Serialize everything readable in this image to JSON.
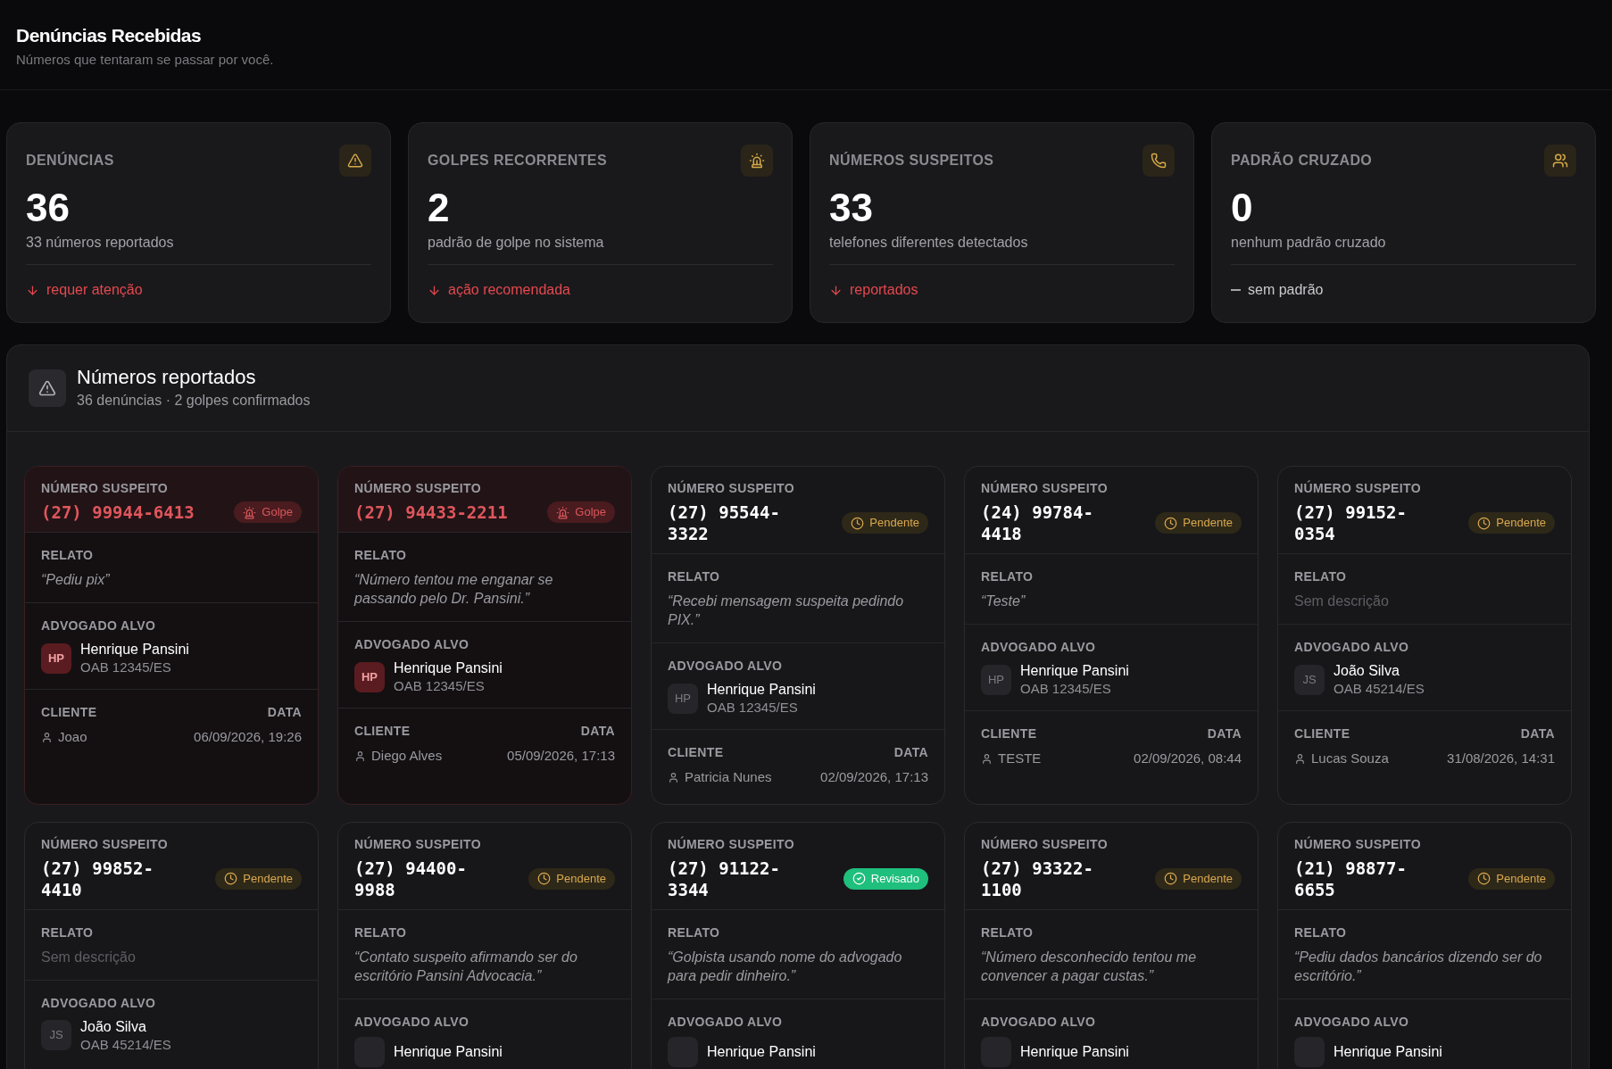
{
  "header": {
    "title": "Denúncias Recebidas",
    "subtitle": "Números que tentaram se passar por você."
  },
  "stats": [
    {
      "label": "DENÚNCIAS",
      "value": "36",
      "caption": "33 números reportados",
      "kind": "down",
      "note": "requer atenção"
    },
    {
      "label": "GOLPES RECORRENTES",
      "value": "2",
      "caption": "padrão de golpe no sistema",
      "kind": "down",
      "note": "ação recomendada"
    },
    {
      "label": "NÚMEROS SUSPEITOS",
      "value": "33",
      "caption": "telefones diferentes detectados",
      "kind": "down",
      "note": "reportados"
    },
    {
      "label": "PADRÃO CRUZADO",
      "value": "0",
      "caption": "nenhum padrão cruzado",
      "kind": "flat",
      "note": "sem padrão"
    }
  ],
  "section": {
    "title": "Números reportados",
    "subtitle": "36 denúncias · 2 golpes confirmados"
  },
  "reports": [
    {
      "number_label": "NÚMERO SUSPEITO",
      "number": "(27) 99944-6413",
      "status": {
        "kind": "golpe",
        "label": "Golpe"
      },
      "report_label": "RELATO",
      "report": "“Pediu pix”",
      "has_report": true,
      "lawyer_label": "ADVOGADO ALVO",
      "lawyer": {
        "initials": "HP",
        "name": "Henrique Pansini",
        "oab": "OAB 12345/ES"
      },
      "client_label": "CLIENTE",
      "client": "Joao",
      "date_label": "DATA",
      "date": "06/09/2026, 19:26"
    },
    {
      "number_label": "NÚMERO SUSPEITO",
      "number": "(27) 94433-2211",
      "status": {
        "kind": "golpe",
        "label": "Golpe"
      },
      "report_label": "RELATO",
      "report": "“Número tentou me enganar se passando pelo Dr. Pansini.”",
      "has_report": true,
      "lawyer_label": "ADVOGADO ALVO",
      "lawyer": {
        "initials": "HP",
        "name": "Henrique Pansini",
        "oab": "OAB 12345/ES"
      },
      "client_label": "CLIENTE",
      "client": "Diego Alves",
      "date_label": "DATA",
      "date": "05/09/2026, 17:13"
    },
    {
      "number_label": "NÚMERO SUSPEITO",
      "number": "(27) 95544-3322",
      "status": {
        "kind": "pendente",
        "label": "Pendente"
      },
      "report_label": "RELATO",
      "report": "“Recebi mensagem suspeita pedindo PIX.”",
      "has_report": true,
      "lawyer_label": "ADVOGADO ALVO",
      "lawyer": {
        "initials": "HP",
        "name": "Henrique Pansini",
        "oab": "OAB 12345/ES"
      },
      "client_label": "CLIENTE",
      "client": "Patricia Nunes",
      "date_label": "DATA",
      "date": "02/09/2026, 17:13"
    },
    {
      "number_label": "NÚMERO SUSPEITO",
      "number": "(24) 99784-4418",
      "status": {
        "kind": "pendente",
        "label": "Pendente"
      },
      "report_label": "RELATO",
      "report": "“Teste”",
      "has_report": true,
      "lawyer_label": "ADVOGADO ALVO",
      "lawyer": {
        "initials": "HP",
        "name": "Henrique Pansini",
        "oab": "OAB 12345/ES"
      },
      "client_label": "CLIENTE",
      "client": "TESTE",
      "date_label": "DATA",
      "date": "02/09/2026, 08:44"
    },
    {
      "number_label": "NÚMERO SUSPEITO",
      "number": "(27) 99152-0354",
      "status": {
        "kind": "pendente",
        "label": "Pendente"
      },
      "report_label": "RELATO",
      "report": "Sem descrição",
      "has_report": false,
      "lawyer_label": "ADVOGADO ALVO",
      "lawyer": {
        "initials": "JS",
        "name": "João Silva",
        "oab": "OAB 45214/ES"
      },
      "client_label": "CLIENTE",
      "client": "Lucas Souza",
      "date_label": "DATA",
      "date": "31/08/2026, 14:31"
    },
    {
      "number_label": "NÚMERO SUSPEITO",
      "number": "(27) 99852-4410",
      "status": {
        "kind": "pendente",
        "label": "Pendente"
      },
      "report_label": "RELATO",
      "report": "Sem descrição",
      "has_report": false,
      "lawyer_label": "ADVOGADO ALVO",
      "lawyer": {
        "initials": "JS",
        "name": "João Silva",
        "oab": "OAB 45214/ES"
      }
    },
    {
      "number_label": "NÚMERO SUSPEITO",
      "number": "(27) 94400-9988",
      "status": {
        "kind": "pendente",
        "label": "Pendente"
      },
      "report_label": "RELATO",
      "report": "“Contato suspeito afirmando ser do escritório Pansini Advocacia.”",
      "has_report": true,
      "lawyer_label": "ADVOGADO ALVO",
      "lawyer": {
        "name": "Henrique Pansini"
      }
    },
    {
      "number_label": "NÚMERO SUSPEITO",
      "number": "(27) 91122-3344",
      "status": {
        "kind": "revisado",
        "label": "Revisado"
      },
      "report_label": "RELATO",
      "report": "“Golpista usando nome do advogado para pedir dinheiro.”",
      "has_report": true,
      "lawyer_label": "ADVOGADO ALVO",
      "lawyer": {
        "name": "Henrique Pansini"
      }
    },
    {
      "number_label": "NÚMERO SUSPEITO",
      "number": "(27) 93322-1100",
      "status": {
        "kind": "pendente",
        "label": "Pendente"
      },
      "report_label": "RELATO",
      "report": "“Número desconhecido tentou me convencer a pagar custas.”",
      "has_report": true,
      "lawyer_label": "ADVOGADO ALVO",
      "lawyer": {
        "name": "Henrique Pansini"
      }
    },
    {
      "number_label": "NÚMERO SUSPEITO",
      "number": "(21) 98877-6655",
      "status": {
        "kind": "pendente",
        "label": "Pendente"
      },
      "report_label": "RELATO",
      "report": "“Pediu dados bancários dizendo ser do escritório.”",
      "has_report": true,
      "lawyer_label": "ADVOGADO ALVO",
      "lawyer": {
        "name": "Henrique Pansini"
      }
    }
  ]
}
